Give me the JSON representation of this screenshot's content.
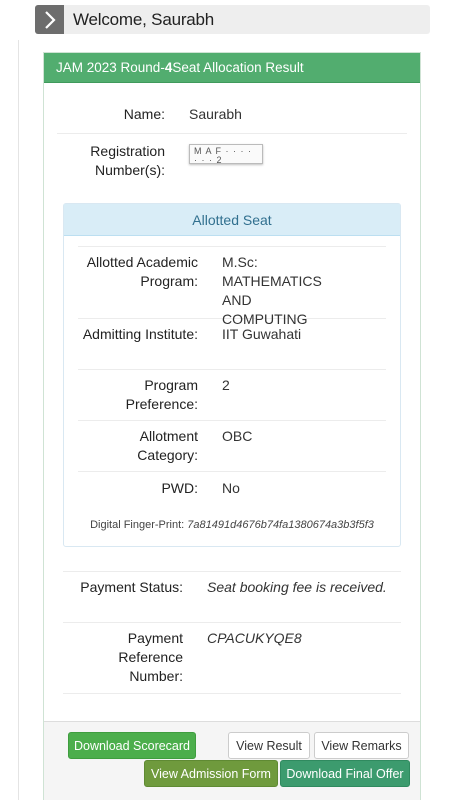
{
  "welcome": {
    "text": "Welcome, Saurabh"
  },
  "panel": {
    "title_prefix": "JAM 2023 Round-",
    "title_round": "4",
    "title_suffix": " Seat Allocation Result"
  },
  "candidate": {
    "name_label": "Name:",
    "name_value": "Saurabh",
    "reg_label": "Registration Number(s):",
    "reg_value": "M A F  ·  ·  ·  ·  ·  ·  · 2"
  },
  "seat": {
    "header": "Allotted Seat",
    "rows": [
      {
        "label": "Allotted Academic Program:",
        "value": "M.Sc: MATHEMATICS AND COMPUTING"
      },
      {
        "label": "Admitting Institute:",
        "value": "IIT Guwahati"
      },
      {
        "label": "Program Preference:",
        "value": "2"
      },
      {
        "label": "Allotment Category:",
        "value": "OBC"
      },
      {
        "label": "PWD:",
        "value": "No"
      }
    ],
    "fingerprint_label": "Digital Finger-Print: ",
    "fingerprint_value": "7a81491d4676b74fa1380674a3b3f5f3"
  },
  "payment": {
    "status_label": "Payment Status:",
    "status_value": "Seat booking fee is received.",
    "ref_label": "Payment Reference Number:",
    "ref_value": "CPACUKYQE8"
  },
  "buttons": {
    "download_scorecard": "Download Scorecard",
    "view_result": "View Result",
    "view_remarks": "View Remarks",
    "view_admission_form": "View Admission Form",
    "download_final_offer": "Download Final Offer"
  },
  "colors": {
    "panel_header": "#52ad6f",
    "seat_header": "#d9edf7",
    "btn_green": "#4cae4c"
  },
  "icons": {
    "welcome": "chevron-right-icon"
  }
}
